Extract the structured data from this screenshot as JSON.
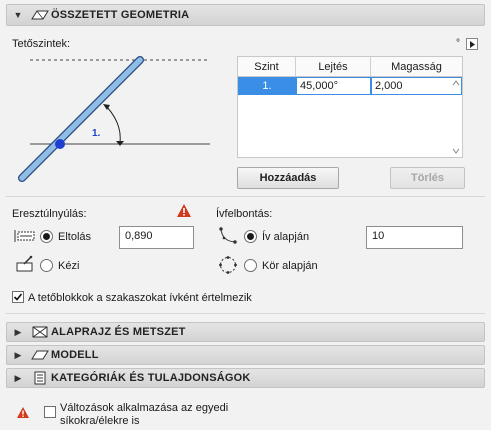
{
  "header": {
    "title": "ÖSSZETETT GEOMETRIA",
    "icon": "roof-geometry-icon"
  },
  "roof_levels": {
    "label": "Tetőszintek:",
    "menu_symbol": "°",
    "diagram_label": "1.",
    "table": {
      "columns": [
        "Szint",
        "Lejtés",
        "Magasság"
      ],
      "rows": [
        {
          "level": "1.",
          "slope": "45,000°",
          "height": "2,000"
        }
      ]
    },
    "add_button": "Hozzáadás",
    "delete_button": "Törlés"
  },
  "eave_overhang": {
    "label": "Eresztúlnyúlás:",
    "options": [
      {
        "label": "Eltolás",
        "selected": true,
        "icon": "offset-icon"
      },
      {
        "label": "Kézi",
        "selected": false,
        "icon": "manual-icon"
      }
    ],
    "value": "0,890",
    "warning_icon": "warning-icon"
  },
  "arc_resolution": {
    "label": "Ívfelbontás:",
    "options": [
      {
        "label": "Ív alapján",
        "selected": true,
        "icon": "arc-icon"
      },
      {
        "label": "Kör alapján",
        "selected": false,
        "icon": "circle-icon"
      }
    ],
    "value": "10"
  },
  "arc_checkbox": {
    "label": "A tetőblokkok a szakaszokat ívként értelmezik",
    "checked": true
  },
  "sections": [
    {
      "title": "ALAPRAJZ ÉS METSZET",
      "icon": "floorplan-section-icon"
    },
    {
      "title": "MODELL",
      "icon": "model-icon"
    },
    {
      "title": "KATEGÓRIÁK ÉS TULAJDONSÁGOK",
      "icon": "categories-icon"
    }
  ],
  "footer": {
    "checkbox_label_line1": "Változások alkalmazása az egyedi",
    "checkbox_label_line2": "síkokra/élekre is",
    "checked": false
  },
  "colors": {
    "accent_blue": "#2b8ae0",
    "pivot_blue": "#1f3fd0",
    "warning_red": "#d23a1e",
    "selection_blue": "#3b8ee6"
  }
}
